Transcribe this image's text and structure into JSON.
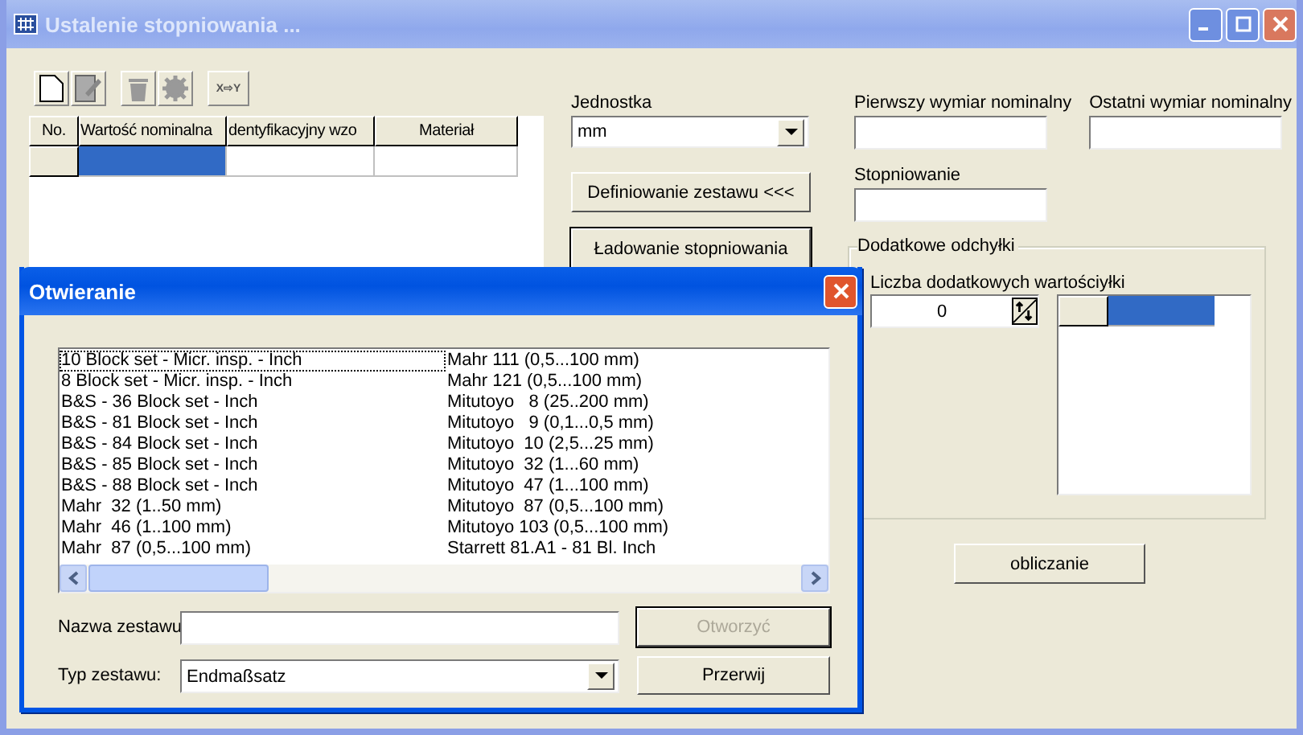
{
  "window": {
    "title": "Ustalenie stopniowania ..."
  },
  "toolbar": [
    {
      "kind": "new",
      "disabled": false
    },
    {
      "kind": "edit",
      "disabled": true
    },
    {
      "kind": "delete",
      "disabled": true
    },
    {
      "kind": "gear",
      "disabled": true
    },
    {
      "kind": "convert",
      "label": "X⇨Y",
      "disabled": false
    }
  ],
  "grid": {
    "columns": [
      "No.",
      "Wartość nominalna",
      "dentyfikacyjny wzo",
      "Materiał"
    ],
    "rows": [
      {
        "cells": [
          {
            "selected": true
          },
          {
            "selected": false
          },
          {
            "selected": false
          }
        ]
      }
    ]
  },
  "unit": {
    "label": "Jednostka",
    "value": "mm"
  },
  "buttons": [
    "Definiowanie zestawu <<<",
    "Ładowanie stopniowania"
  ],
  "fields": [
    {
      "label": "Pierwszy wymiar nominalny"
    },
    {
      "label": "Ostatni wymiar nominalny"
    },
    {
      "label": "Stopniowanie"
    }
  ],
  "extra": {
    "title": "Dodatkowe odchyłki",
    "label": "Liczba dodatkowych wartościyłki",
    "count": "0",
    "rows": [
      {
        "selected": true
      }
    ]
  },
  "calculate_button": "obliczanie",
  "dialog": {
    "title": "Otwieranie",
    "items": [
      {
        "label": "10 Block set - Micr. insp. - Inch",
        "selected": true
      },
      {
        "label": "8 Block set - Micr. insp. - Inch",
        "selected": false
      },
      {
        "label": "B&S - 36 Block set - Inch",
        "selected": false
      },
      {
        "label": "B&S - 81 Block set - Inch",
        "selected": false
      },
      {
        "label": "B&S - 84 Block set - Inch",
        "selected": false
      },
      {
        "label": "B&S - 85 Block set - Inch",
        "selected": false
      },
      {
        "label": "B&S - 88 Block set - Inch",
        "selected": false
      },
      {
        "label": "Mahr  32 (1..50 mm)",
        "selected": false
      },
      {
        "label": "Mahr  46 (1..100 mm)",
        "selected": false
      },
      {
        "label": "Mahr  87 (0,5...100 mm)",
        "selected": false
      },
      {
        "label": "Mahr 111 (0,5...100 mm)",
        "selected": false
      },
      {
        "label": "Mahr 121 (0,5...100 mm)",
        "selected": false
      },
      {
        "label": "Mitutoyo   8 (25..200 mm)",
        "selected": false
      },
      {
        "label": "Mitutoyo   9 (0,1...0,5 mm)",
        "selected": false
      },
      {
        "label": "Mitutoyo  10 (2,5...25 mm)",
        "selected": false
      },
      {
        "label": "Mitutoyo  32 (1...60 mm)",
        "selected": false
      },
      {
        "label": "Mitutoyo  47 (1...100 mm)",
        "selected": false
      },
      {
        "label": "Mitutoyo  87 (0,5...100 mm)",
        "selected": false
      },
      {
        "label": "Mitutoyo 103 (0,5...100 mm)",
        "selected": false
      },
      {
        "label": "Starrett 81.A1 - 81 Bl. Inch",
        "selected": false
      }
    ],
    "name_label": "Nazwa zestawu",
    "type_label": "Typ zestawu:",
    "type_value": "Endmaßsatz",
    "open_button": {
      "label": "Otworzyć",
      "disabled": true
    },
    "cancel_button": "Przerwij"
  }
}
